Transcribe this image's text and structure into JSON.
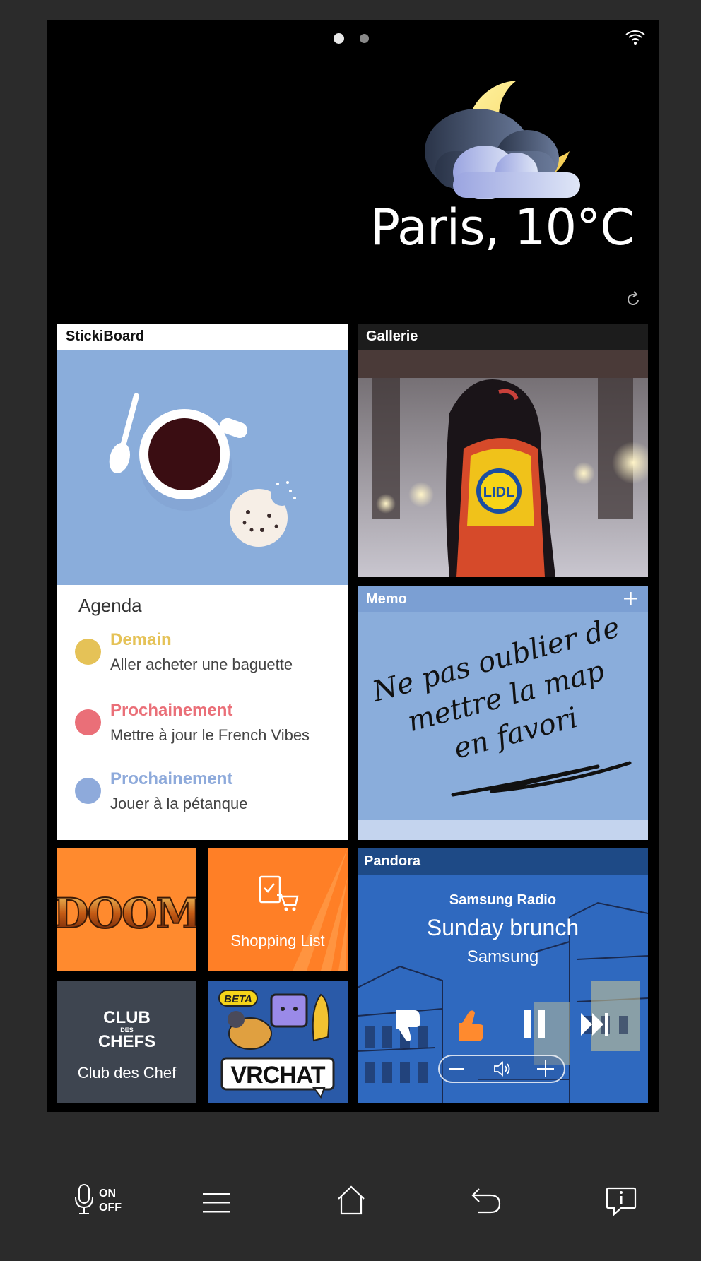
{
  "status": {
    "page_indicator": {
      "current": 1,
      "total": 2
    },
    "wifi_icon": "wifi-icon"
  },
  "weather": {
    "icon": "moon-cloud-icon",
    "city_temp": "Paris, 10°C",
    "refresh_icon": "refresh-icon"
  },
  "stickiboard": {
    "title": "StickiBoard",
    "image": "coffee-cup-illustration",
    "agenda_title": "Agenda",
    "items": [
      {
        "when": "Demain",
        "what": "Aller acheter une baguette",
        "color": "#e5c257"
      },
      {
        "when": "Prochainement",
        "what": "Mettre à jour le French Vibes",
        "color": "#ea6f78"
      },
      {
        "when": "Prochainement",
        "what": "Jouer à la pétanque",
        "color": "#8eaadb"
      }
    ]
  },
  "gallery": {
    "title": "Gallerie",
    "badge": "LIDL"
  },
  "memo": {
    "title": "Memo",
    "add_icon": "plus-icon",
    "lines": [
      "Ne pas oublier de",
      "mettre la map",
      "en favori"
    ]
  },
  "apps": [
    {
      "label": "DOOM"
    },
    {
      "label": "Shopping List",
      "icon": "shopping-cart-icon"
    },
    {
      "label": "Club des Chef",
      "logo_lines": [
        "CLUB",
        "DES",
        "CHEFS"
      ]
    },
    {
      "label": "VRCHAT",
      "badge": "BETA"
    }
  ],
  "pandora": {
    "title": "Pandora",
    "station": "Samsung Radio",
    "song": "Sunday brunch",
    "artist": "Samsung",
    "controls": [
      "thumbs-down-icon",
      "thumbs-up-icon",
      "pause-icon",
      "skip-icon"
    ],
    "volume": [
      "minus-icon",
      "volume-icon",
      "plus-icon"
    ]
  },
  "nav": {
    "mic_on": "ON",
    "mic_off": "OFF",
    "icons": [
      "microphone-icon",
      "menu-icon",
      "home-icon",
      "back-icon",
      "info-icon"
    ]
  },
  "colors": {
    "accent_orange": "#ff8a2e",
    "tile_blue": "#8aaddb",
    "pandora_blue": "#2f69bf",
    "demain_yellow": "#e5c257",
    "prochainement_red": "#ea6f78",
    "prochainement_blue": "#8eaadb"
  }
}
